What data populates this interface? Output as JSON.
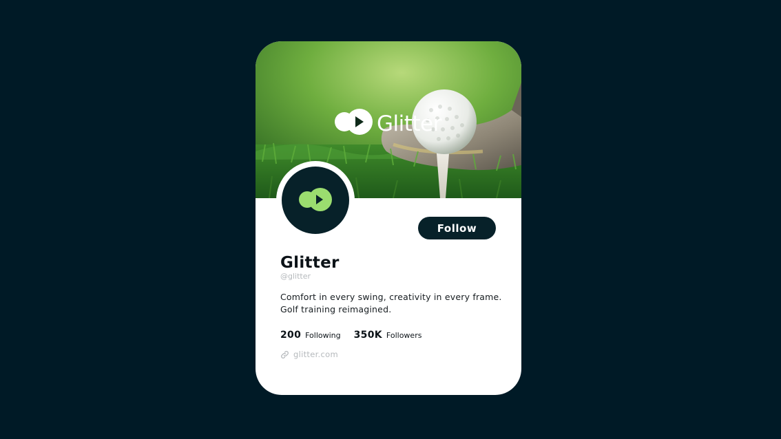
{
  "profile": {
    "banner_brand": "Glitter",
    "name": "Glitter",
    "handle": "@glitter",
    "bio_line1": "Comfort in every swing, creativity in every frame.",
    "bio_line2": "Golf training reimagined.",
    "following_count": "200",
    "following_label": "Following",
    "followers_count": "350K",
    "followers_label": "Followers",
    "website": "glitter.com"
  },
  "actions": {
    "follow_label": "Follow"
  },
  "icons": {
    "brand": "glitter-logo-icon",
    "link": "link-icon"
  },
  "colors": {
    "page_background": "#001a26",
    "accent_dark": "#072129",
    "brand_green": "#9bdd6f",
    "muted_text": "#b5b9bc"
  }
}
